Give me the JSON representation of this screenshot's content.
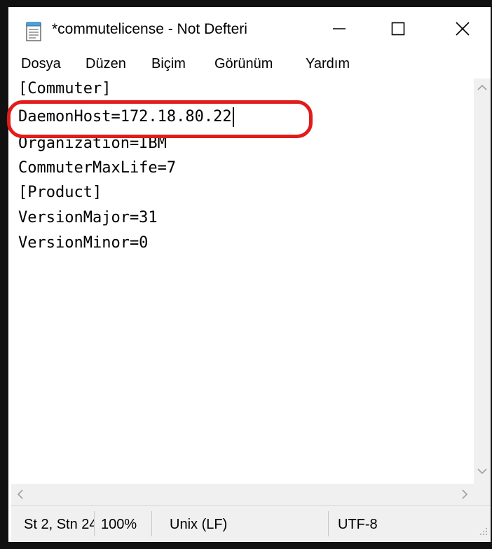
{
  "window": {
    "title": "*commutelicense - Not Defteri",
    "icons": {
      "app": "notepad-icon",
      "minimize": "minimize-icon",
      "maximize": "maximize-icon",
      "close": "close-icon"
    }
  },
  "menu": {
    "items": [
      "Dosya",
      "Düzen",
      "Biçim",
      "Görünüm",
      "Yardım"
    ]
  },
  "editor": {
    "lines": [
      "[Commuter]",
      "DaemonHost=172.18.80.22",
      "Organization=IBM",
      "CommuterMaxLife=7",
      "[Product]",
      "VersionMajor=31",
      "VersionMinor=0"
    ],
    "highlight_color": "#e21b1b"
  },
  "status": {
    "position": "St 2, Stn 24",
    "zoom": "100%",
    "line_ending": "Unix (LF)",
    "encoding": "UTF-8"
  }
}
